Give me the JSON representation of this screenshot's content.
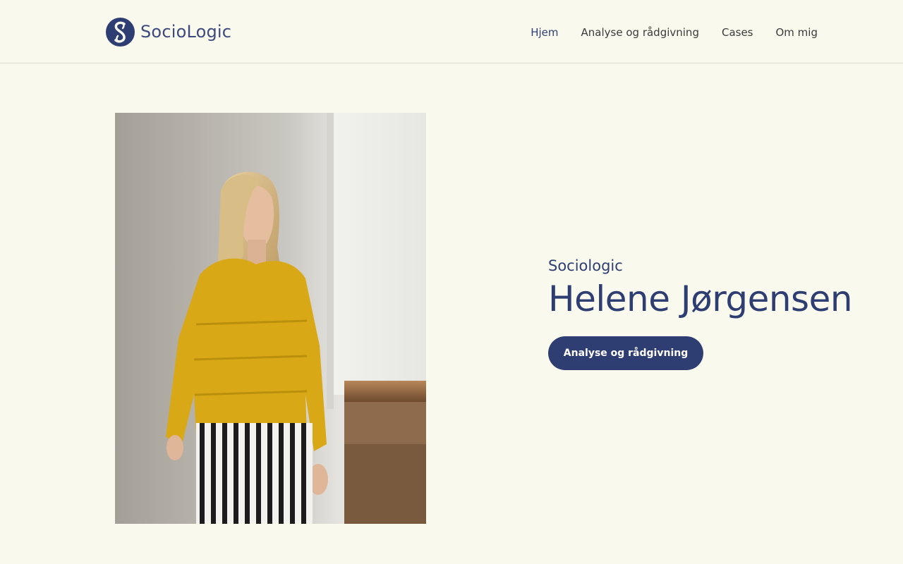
{
  "brand": {
    "logo_text": "SocioLogic",
    "icon": "s-monogram-logo"
  },
  "nav": {
    "items": [
      {
        "label": "Hjem",
        "active": true
      },
      {
        "label": "Analyse og rådgivning",
        "active": false
      },
      {
        "label": "Cases",
        "active": false
      },
      {
        "label": "Om mig",
        "active": false
      }
    ]
  },
  "hero": {
    "kicker": "Sociologic",
    "name": "Helene Jørgensen",
    "cta_label": "Analyse og rådgivning",
    "photo_description": "portrait"
  },
  "colors": {
    "background": "#f9f9ee",
    "accent": "#2f3e72",
    "nav_text": "#3b3b3b"
  }
}
